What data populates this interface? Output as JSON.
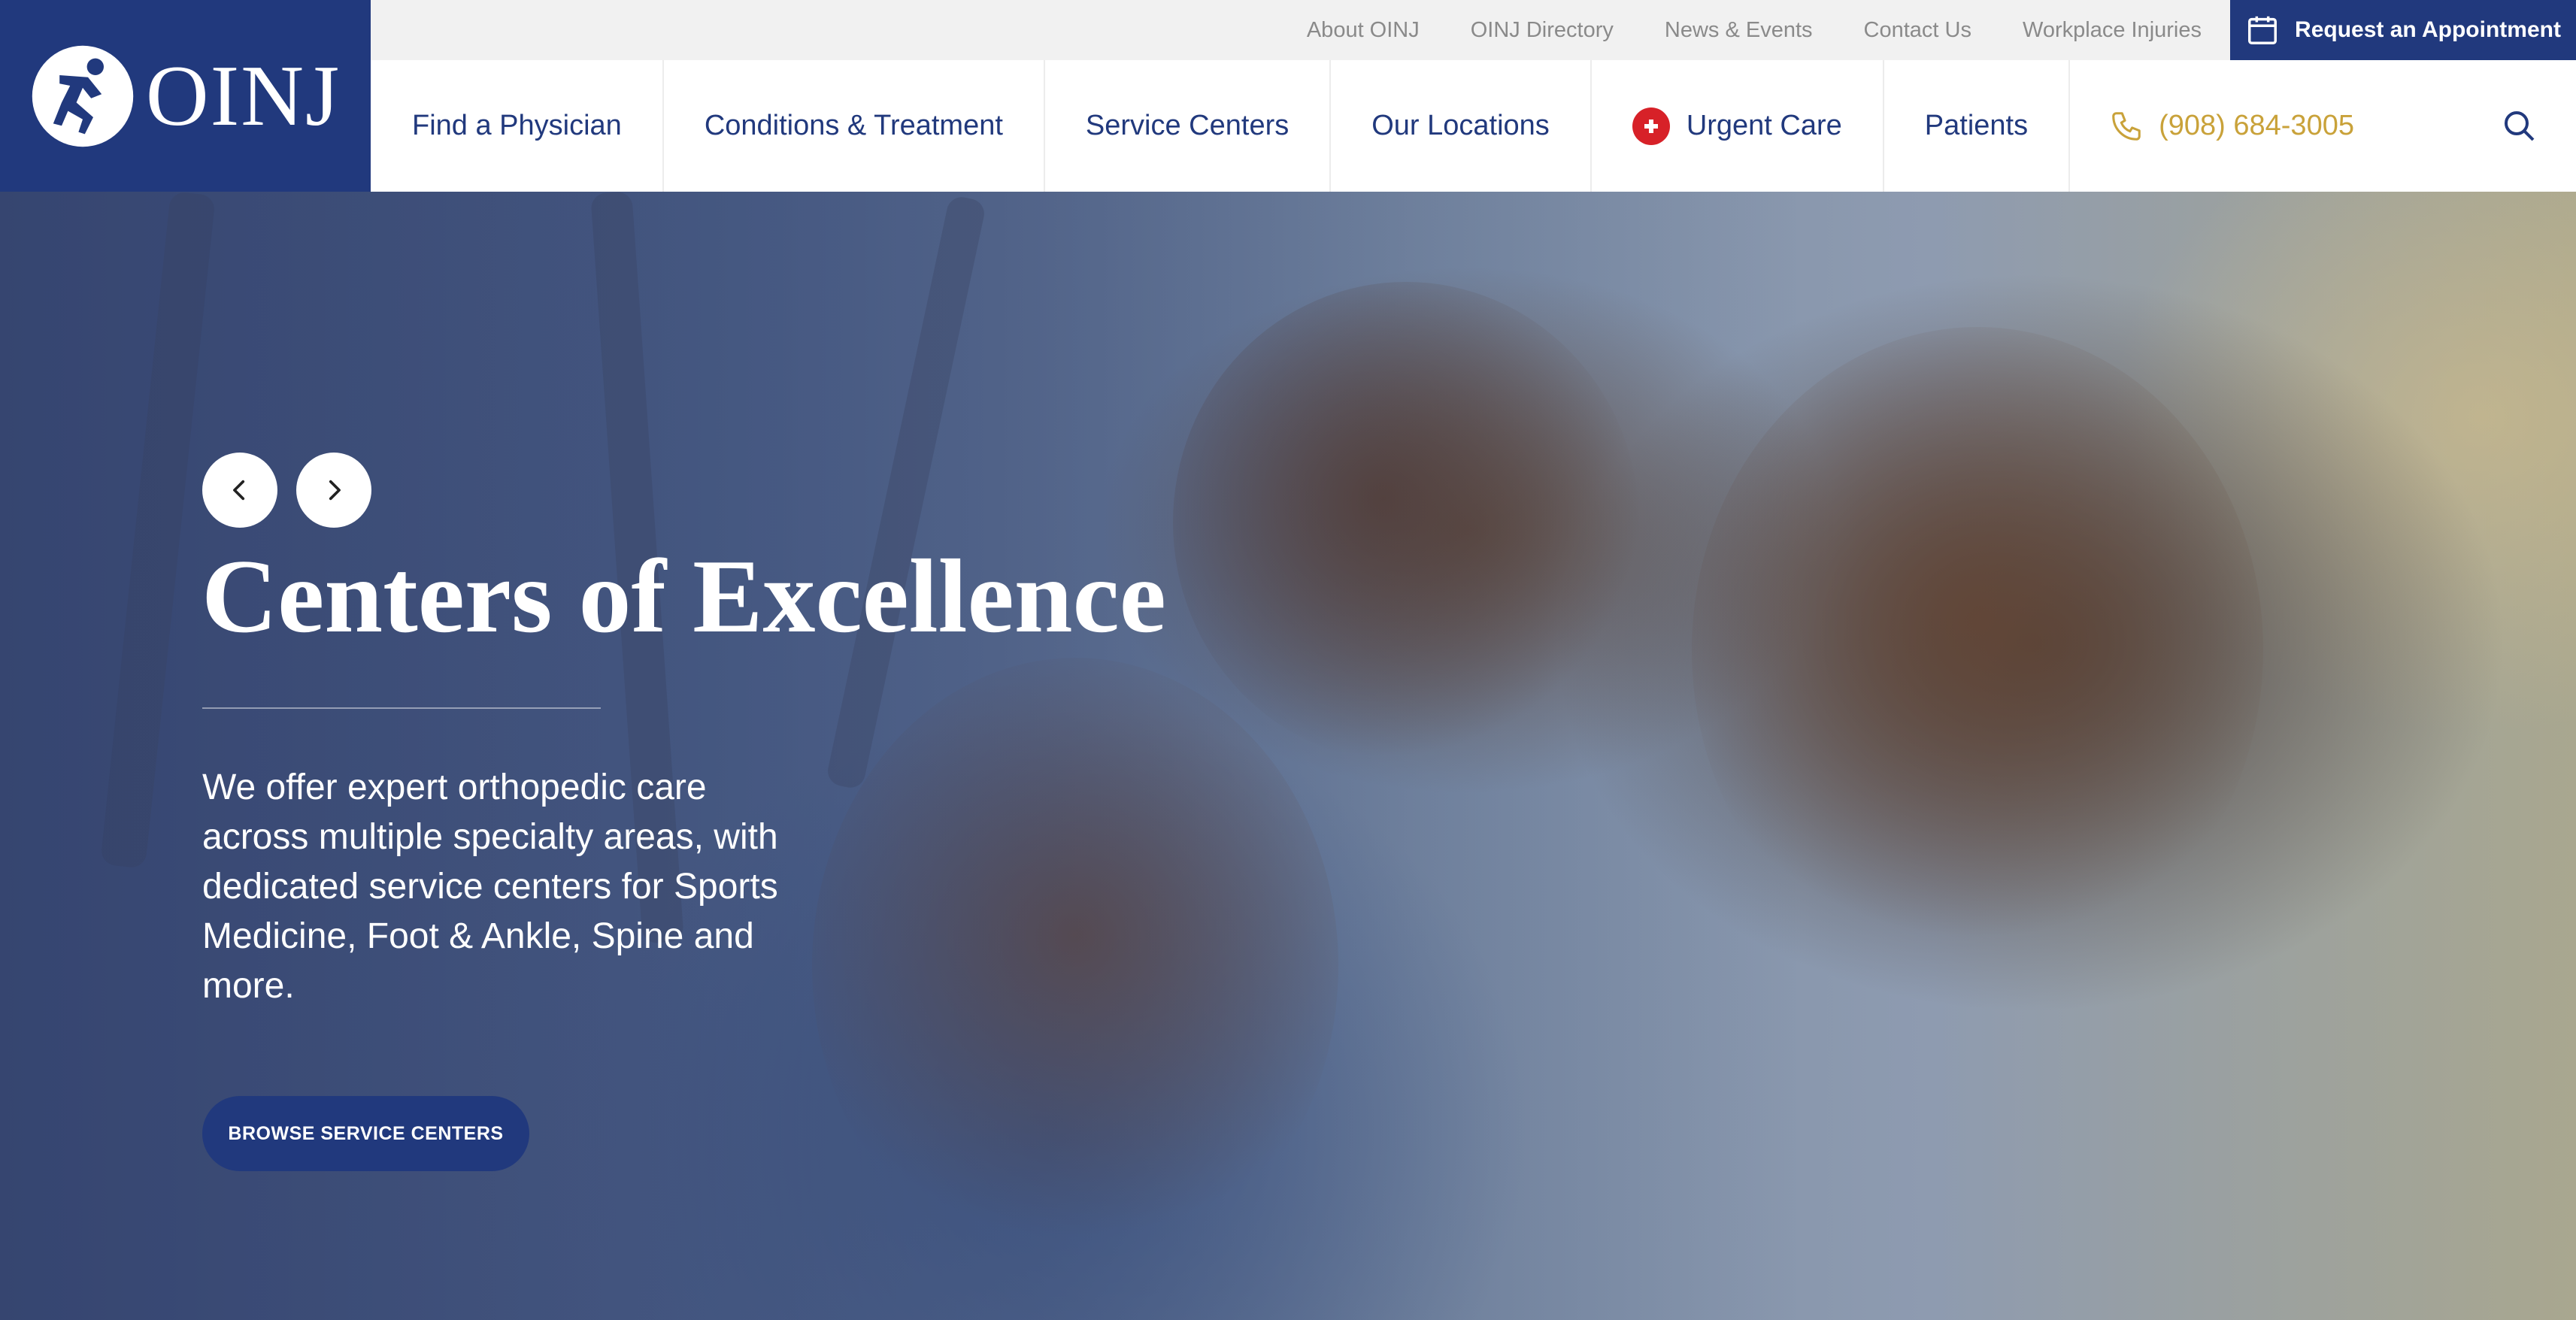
{
  "brand": {
    "name": "OINJ",
    "color": "#21397d"
  },
  "utility": {
    "links": [
      "About OINJ",
      "OINJ Directory",
      "News & Events",
      "Contact Us",
      "Workplace Injuries"
    ],
    "appointment_label": "Request an Appointment"
  },
  "nav": {
    "items": [
      "Find a Physician",
      "Conditions & Treatment",
      "Service Centers",
      "Our Locations",
      "Urgent Care",
      "Patients"
    ],
    "phone": "(908) 684-3005",
    "phone_color": "#c9a23a",
    "urgent_color": "#d72128"
  },
  "hero": {
    "title": "Centers of Excellence",
    "description": "We offer expert orthopedic care across multiple specialty areas, with dedicated service centers for Sports Medicine, Foot & Ankle, Spine and more.",
    "cta_label": "BROWSE SERVICE CENTERS"
  },
  "icons": [
    "oinj-logo-icon",
    "calendar-icon",
    "urgent-care-plus-icon",
    "phone-icon",
    "search-icon",
    "chevron-left-icon",
    "chevron-right-icon"
  ]
}
